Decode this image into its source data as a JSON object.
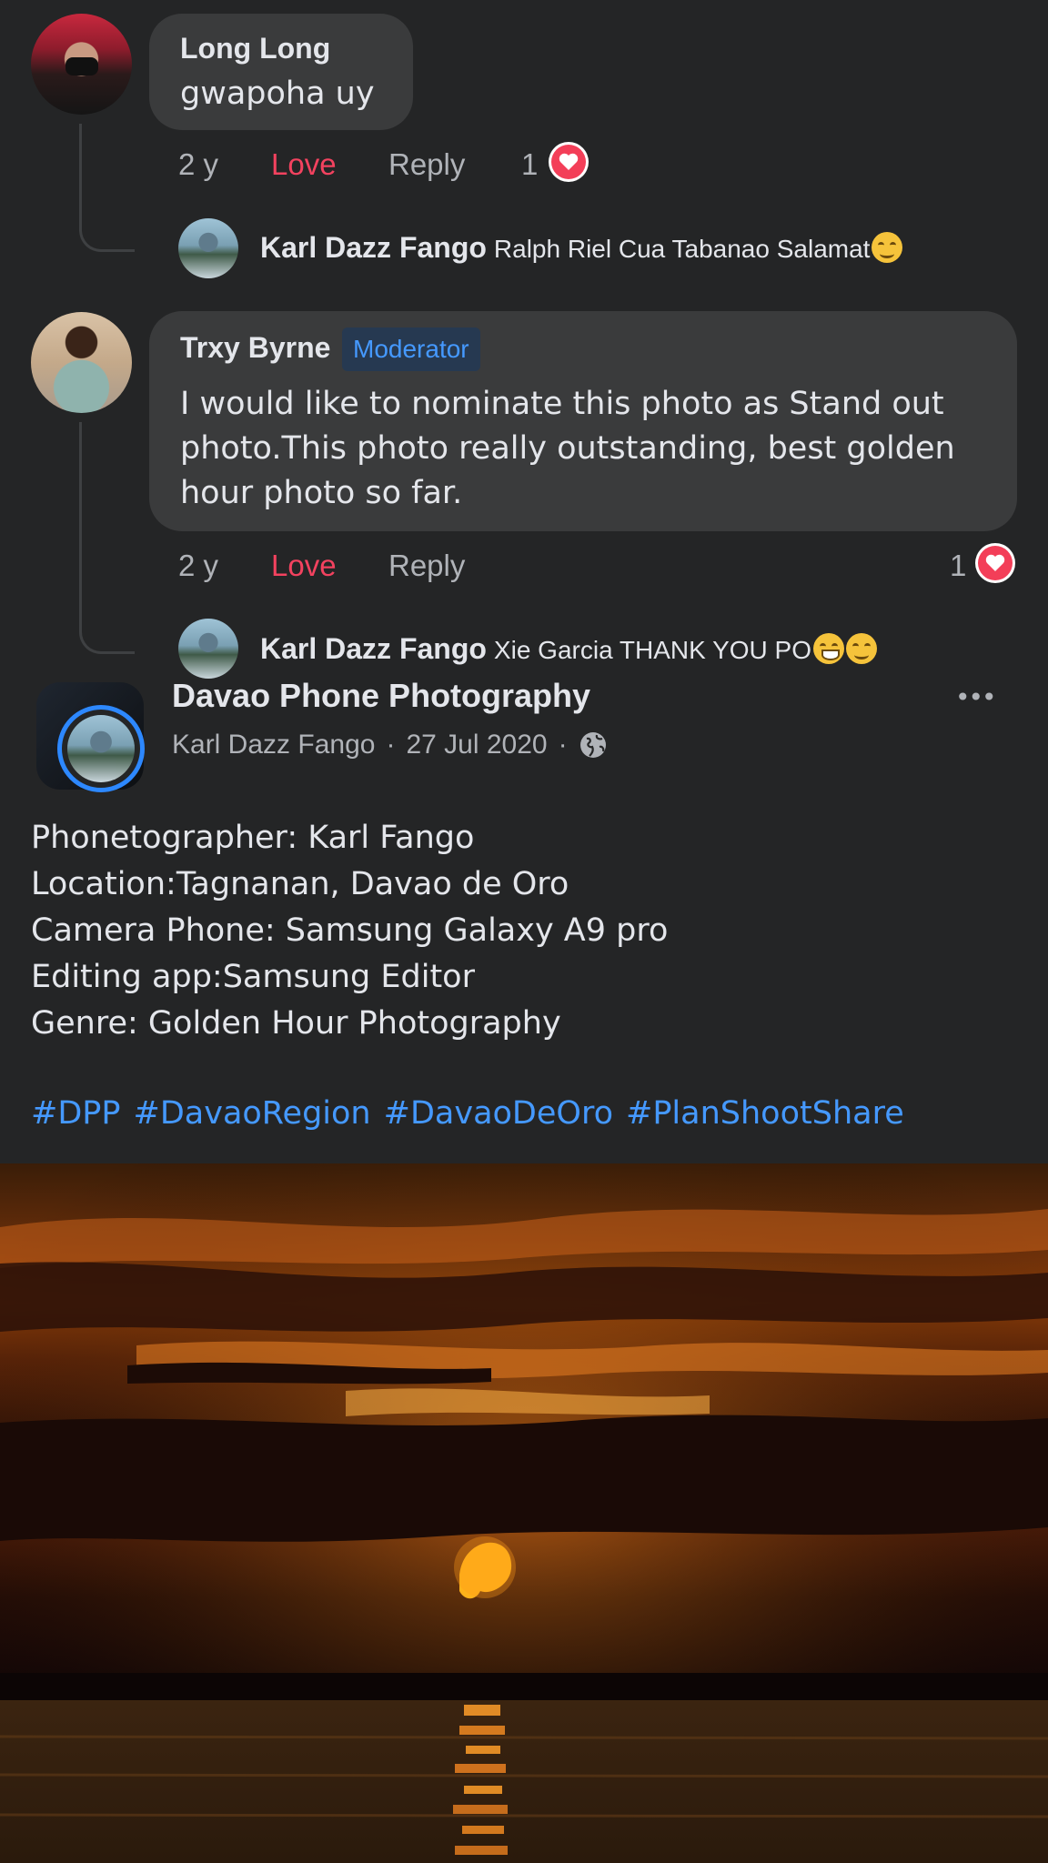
{
  "comments": [
    {
      "name": "Long Long",
      "text": "gwapoha uy",
      "time": "2 y",
      "love_label": "Love",
      "reply_label": "Reply",
      "reaction_count": "1",
      "reply": {
        "name": "Karl Dazz Fango",
        "text": "Ralph Riel Cua Tabanao Salamat"
      }
    },
    {
      "name": "Trxy Byrne",
      "badge": "Moderator",
      "text": "I would like to nominate this photo as Stand out photo.This photo really outstanding, best golden hour photo so far.",
      "time": "2 y",
      "love_label": "Love",
      "reply_label": "Reply",
      "reaction_count": "1",
      "reply": {
        "name": "Karl Dazz Fango",
        "text": "Xie Garcia THANK YOU PO"
      }
    }
  ],
  "post": {
    "group_name": "Davao Phone Photography",
    "author": "Karl Dazz Fango",
    "separator": "·",
    "date": "27 Jul 2020",
    "more_label": "•••",
    "body": "Phonetographer: Karl Fango\nLocation:Tagnanan, Davao de Oro\nCamera Phone: Samsung Galaxy A9 pro\nEditing app:Samsung Editor\nGenre: Golden Hour Photography",
    "hashtags": [
      "#DPP",
      "#DavaoRegion",
      "#DavaoDeOro",
      "#PlanShootShare"
    ]
  },
  "colors": {
    "background": "#242526",
    "bubble": "#3a3b3c",
    "love": "#f3425f",
    "link": "#4599ff",
    "badge_bg": "#263951",
    "badge_text": "#4599ff"
  }
}
